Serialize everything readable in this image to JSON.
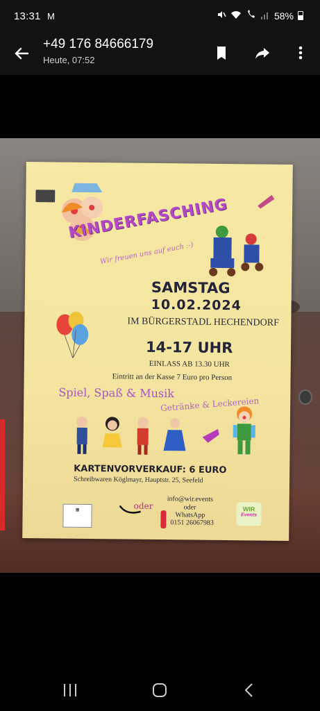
{
  "status_bar": {
    "time": "13:31",
    "mail_indicator": "M",
    "battery": "58%",
    "icons": [
      "gmail-icon",
      "mute-icon",
      "wifi-icon",
      "wifi-call-icon",
      "signal-icon",
      "battery-icon"
    ]
  },
  "header": {
    "title": "+49 176 84666179",
    "subtitle": "Heute, 07:52",
    "icons": [
      "back-arrow-icon",
      "bookmark-icon",
      "share-forward-icon",
      "more-vert-icon"
    ]
  },
  "poster": {
    "title": "KINDERFASCHING",
    "tagline": "Wir freuen uns auf euch :-)",
    "day": "SAMSTAG",
    "date": "10.02.2024",
    "venue": "IM BÜRGERSTADL HECHENDORF",
    "time": "14-17 UHR",
    "entry": "EINLASS AB 13.30 UHR",
    "price": "Eintritt an der Kasse 7 Euro pro Person",
    "fun": "Spiel, Spaß & Musik",
    "drinks": "Getränke & Leckereien",
    "presale": "KARTENVORVERKAUF: 6 EURO",
    "shop": "Schreibwaren Köglmayr, Hauptstr. 25, Seefeld",
    "oder1": "oder",
    "email": "info@wir.events",
    "oder2": "oder",
    "whatsapp": "WhatsApp",
    "phone": "0151 26067983",
    "wir_logo": "WIR",
    "wir_logo_sub": "Events"
  },
  "nav": {
    "icons": [
      "recent-apps-icon",
      "home-icon",
      "back-icon"
    ]
  },
  "colors": {
    "bar_bg": "#121212",
    "poster_bg": "#f6e9a4",
    "title_purple": "#b54ac9"
  }
}
